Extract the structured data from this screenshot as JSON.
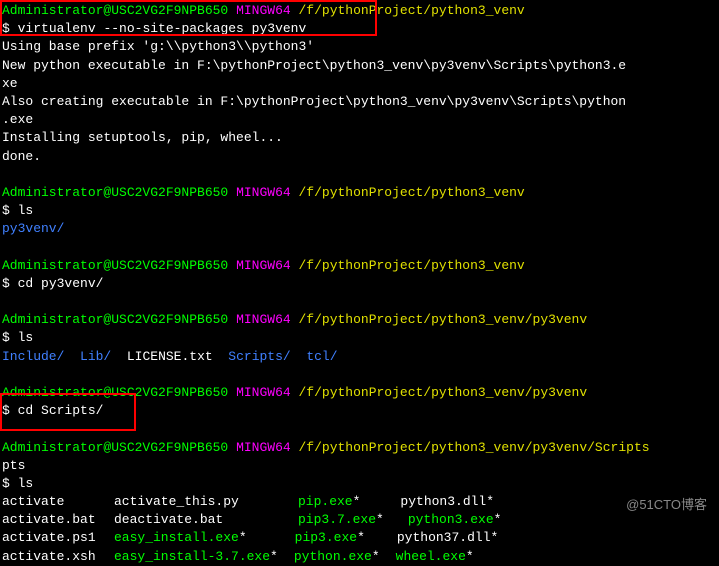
{
  "prompt": {
    "user": "Administrator@USC2VG2F9NPB650",
    "shell": "MINGW64",
    "path1": "/f/pythonProject/python3_venv",
    "path2": "/f/pythonProject/python3_venv/py3venv",
    "path3": "/f/pythonProject/python3_venv/py3venv/Scripts",
    "dollar": "$"
  },
  "cmds": {
    "virtualenv": "virtualenv --no-site-packages py3venv",
    "ls": "ls",
    "cd_py3venv": "cd py3venv/",
    "cd_scripts": "cd Scripts/"
  },
  "out": {
    "l1": "Using base prefix 'g:\\\\python3\\\\python3'",
    "l2": "New python executable in F:\\pythonProject\\python3_venv\\py3venv\\Scripts\\python3.e",
    "l3": "xe",
    "l4": "Also creating executable in F:\\pythonProject\\python3_venv\\py3venv\\Scripts\\python",
    "l5": ".exe",
    "l6": "Installing setuptools, pip, wheel...",
    "l7": "done."
  },
  "dirs": {
    "py3venv": "py3venv/",
    "include": "Include/",
    "lib": "Lib/",
    "license": "LICENSE.txt",
    "scripts": "Scripts/",
    "tcl": "tcl/",
    "pts": "pts"
  },
  "files": {
    "r1": {
      "c1": "activate",
      "c2": "activate_this.py",
      "c3": "pip.exe",
      "c4": "python3.dll"
    },
    "r2": {
      "c1": "activate.bat",
      "c2": "deactivate.bat",
      "c3": "pip3.7.exe",
      "c4": "python3.exe"
    },
    "r3": {
      "c1": "activate.ps1",
      "c2": "easy_install.exe",
      "c3": "pip3.exe",
      "c4": "python37.dll"
    },
    "r4": {
      "c1": "activate.xsh",
      "c2": "easy_install-3.7.exe",
      "c3": "python.exe",
      "c4": "wheel.exe"
    }
  },
  "star": "*",
  "watermark": "@51CTO博客"
}
